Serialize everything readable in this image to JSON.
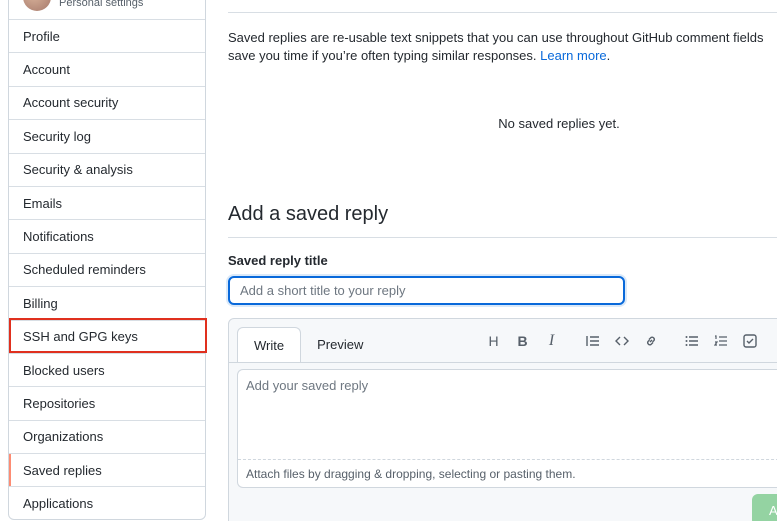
{
  "sidebar": {
    "subtitle": "Personal settings",
    "items": [
      {
        "label": "Profile"
      },
      {
        "label": "Account"
      },
      {
        "label": "Account security"
      },
      {
        "label": "Security log"
      },
      {
        "label": "Security & analysis"
      },
      {
        "label": "Emails"
      },
      {
        "label": "Notifications"
      },
      {
        "label": "Scheduled reminders"
      },
      {
        "label": "Billing"
      },
      {
        "label": "SSH and GPG keys"
      },
      {
        "label": "Blocked users"
      },
      {
        "label": "Repositories"
      },
      {
        "label": "Organizations"
      },
      {
        "label": "Saved replies"
      },
      {
        "label": "Applications"
      }
    ]
  },
  "main": {
    "intro_line1": "Saved replies are re-usable text snippets that you can use throughout GitHub comment fields",
    "intro_line2": "save you time if you’re often typing similar responses.",
    "learn_more": "Learn more",
    "intro_end": ".",
    "empty_state": "No saved replies yet.",
    "add_heading": "Add a saved reply",
    "title_label": "Saved reply title",
    "title_placeholder": "Add a short title to your reply",
    "tabs": [
      {
        "label": "Write"
      },
      {
        "label": "Preview"
      }
    ],
    "toolbar": [
      "heading-icon",
      "bold-icon",
      "italic-icon",
      "quote-icon",
      "code-icon",
      "link-icon",
      "unordered-list-icon",
      "ordered-list-icon",
      "task-list-icon"
    ],
    "body_placeholder": "Add your saved reply",
    "attach_hint": "Attach files by dragging & dropping, selecting or pasting them.",
    "add_button": "A"
  },
  "colors": {
    "link": "#0969da",
    "focus": "#0969da",
    "active_marker": "#fd8c73",
    "highlight_box": "#e0301e",
    "button_disabled": "#94d3a2"
  }
}
